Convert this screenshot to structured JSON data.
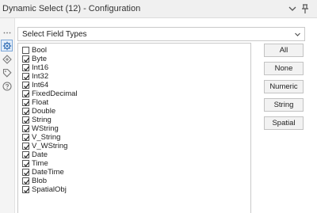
{
  "window": {
    "title": "Dynamic Select (12) - Configuration"
  },
  "icons": {
    "dropdown": "chevron-down-icon",
    "pin": "pin-icon",
    "rail": [
      "configuration-gear-icon",
      "connections-icon",
      "annotation-tag-icon",
      "help-icon"
    ]
  },
  "selector": {
    "value": "Select Field Types"
  },
  "field_types": [
    {
      "label": "Bool",
      "checked": false
    },
    {
      "label": "Byte",
      "checked": true
    },
    {
      "label": "Int16",
      "checked": true
    },
    {
      "label": "Int32",
      "checked": true
    },
    {
      "label": "Int64",
      "checked": true
    },
    {
      "label": "FixedDecimal",
      "checked": true
    },
    {
      "label": "Float",
      "checked": true
    },
    {
      "label": "Double",
      "checked": true
    },
    {
      "label": "String",
      "checked": true
    },
    {
      "label": "WString",
      "checked": true
    },
    {
      "label": "V_String",
      "checked": true
    },
    {
      "label": "V_WString",
      "checked": true
    },
    {
      "label": "Date",
      "checked": true
    },
    {
      "label": "Time",
      "checked": true
    },
    {
      "label": "DateTime",
      "checked": true
    },
    {
      "label": "Blob",
      "checked": true
    },
    {
      "label": "SpatialObj",
      "checked": true
    }
  ],
  "buttons": {
    "all": "All",
    "none": "None",
    "numeric": "Numeric",
    "string": "String",
    "spatial": "Spatial"
  },
  "colors": {
    "accent": "#2f6db5",
    "check": "#222222"
  }
}
